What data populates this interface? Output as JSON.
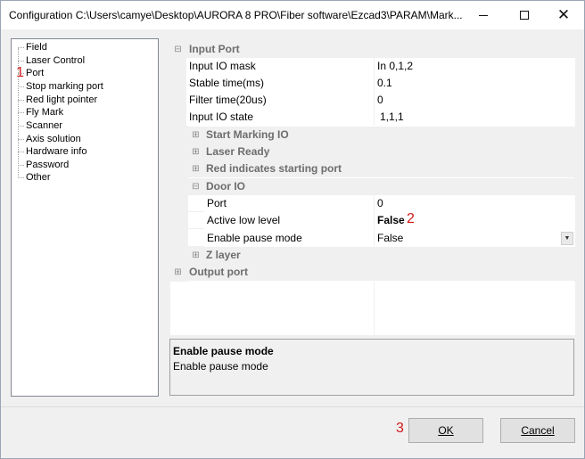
{
  "window": {
    "title": "Configuration C:\\Users\\camye\\Desktop\\AURORA 8 PRO\\Fiber software\\Ezcad3\\PARAM\\Mark..."
  },
  "tree": {
    "items": [
      {
        "label": "Field"
      },
      {
        "label": "Laser Control"
      },
      {
        "label": "Port"
      },
      {
        "label": "Stop marking port"
      },
      {
        "label": "Red light pointer"
      },
      {
        "label": "Fly Mark"
      },
      {
        "label": "Scanner"
      },
      {
        "label": "Axis solution"
      },
      {
        "label": "Hardware info"
      },
      {
        "label": "Password"
      },
      {
        "label": "Other"
      }
    ]
  },
  "annotations": {
    "a1": "1",
    "a2": "2",
    "a3": "3"
  },
  "grid": {
    "input_port": {
      "label": "Input Port",
      "toggle": "⊟",
      "props": [
        {
          "name": "Input IO mask",
          "value": "In 0,1,2"
        },
        {
          "name": "Stable time(ms)",
          "value": "0.1"
        },
        {
          "name": "Filter time(20us)",
          "value": "0"
        },
        {
          "name": "Input IO state",
          "value": "1,1,1"
        }
      ]
    },
    "start_marking_io": {
      "label": "Start Marking IO",
      "toggle": "⊞"
    },
    "laser_ready": {
      "label": "Laser Ready",
      "toggle": "⊞"
    },
    "red_starting_port": {
      "label": "Red indicates starting port",
      "toggle": "⊞"
    },
    "door_io": {
      "label": "Door IO",
      "toggle": "⊟",
      "props": [
        {
          "name": "Port",
          "value": "0"
        },
        {
          "name": "Active low level",
          "value": "False"
        },
        {
          "name": "Enable pause mode",
          "value": "False"
        }
      ]
    },
    "z_layer": {
      "label": "Z layer",
      "toggle": "⊞"
    },
    "output_port": {
      "label": "Output port",
      "toggle": "⊞"
    },
    "dropdown_glyph": "▼"
  },
  "description": {
    "title": "Enable pause mode",
    "text": "Enable pause mode"
  },
  "buttons": {
    "ok": "OK",
    "cancel": "Cancel"
  }
}
